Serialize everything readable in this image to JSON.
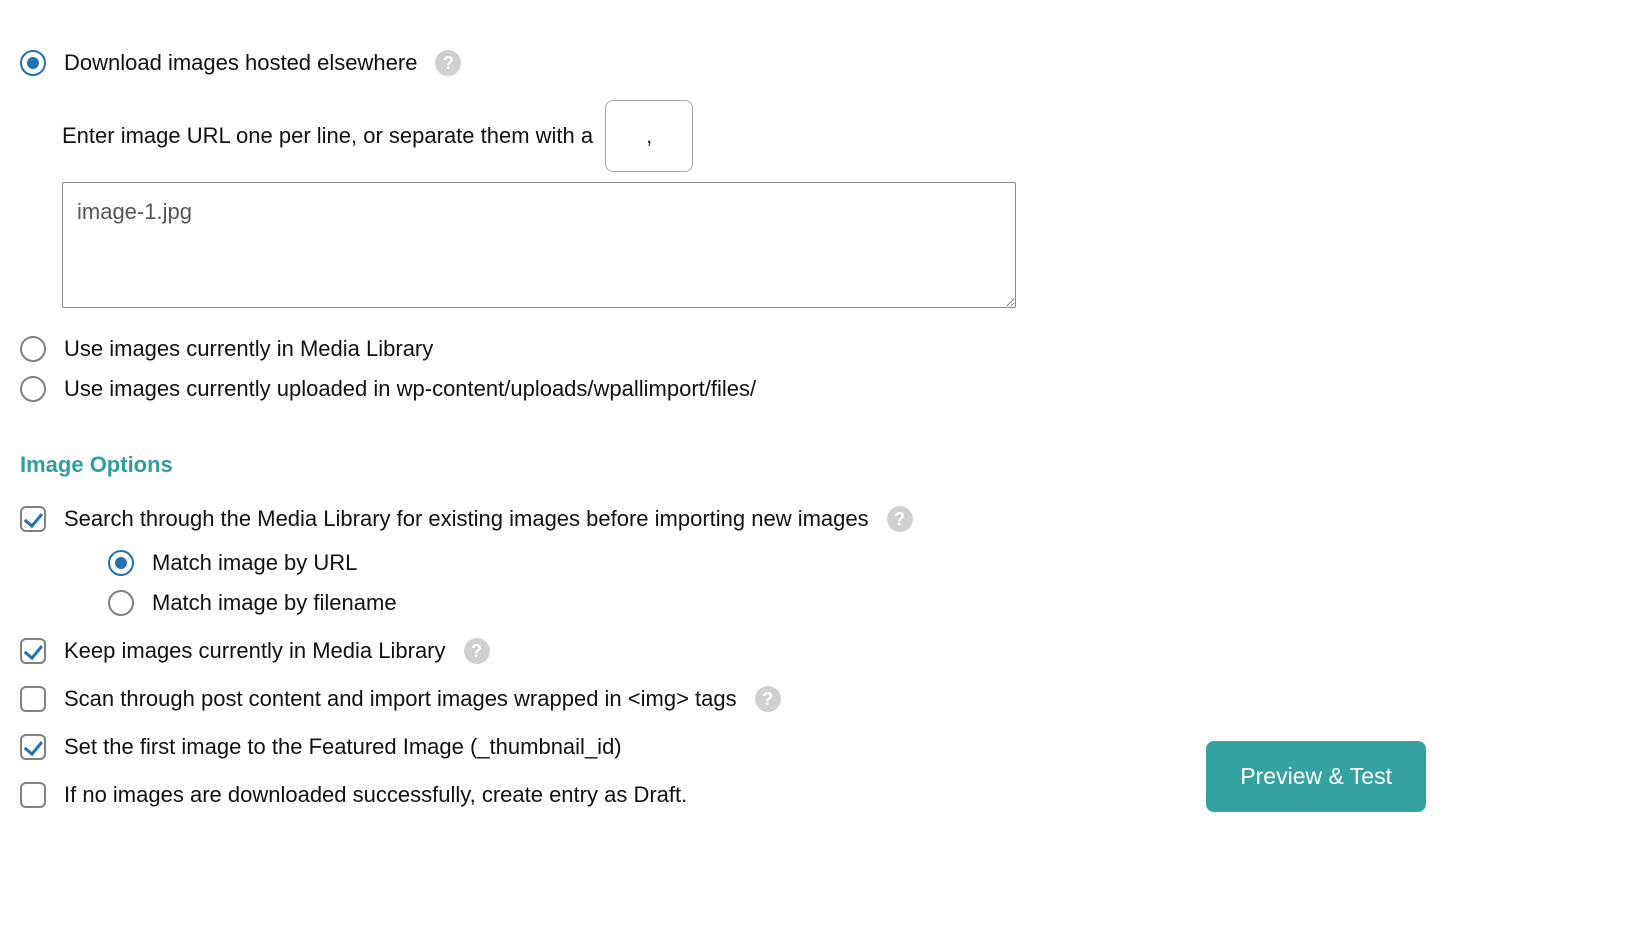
{
  "imageSource": {
    "download": {
      "label": "Download images hosted elsewhere",
      "selected": true,
      "instruction": "Enter image URL one per line, or separate them with a",
      "separator": ",",
      "urls": "image-1.jpg"
    },
    "mediaLibrary": {
      "label": "Use images currently in Media Library",
      "selected": false
    },
    "uploadsFolder": {
      "label": "Use images currently uploaded in wp-content/uploads/wpallimport/files/",
      "selected": false
    }
  },
  "imageOptions": {
    "heading": "Image Options",
    "searchExisting": {
      "label": "Search through the Media Library for existing images before importing new images",
      "checked": true,
      "matchBy": {
        "url": {
          "label": "Match image by URL",
          "selected": true
        },
        "filename": {
          "label": "Match image by filename",
          "selected": false
        }
      }
    },
    "keepImages": {
      "label": "Keep images currently in Media Library",
      "checked": true
    },
    "scanContent": {
      "label": "Scan through post content and import images wrapped in <img> tags",
      "checked": false
    },
    "setFeatured": {
      "label": "Set the first image to the Featured Image (_thumbnail_id)",
      "checked": true
    },
    "draftOnFail": {
      "label": "If no images are downloaded successfully, create entry as Draft.",
      "checked": false
    }
  },
  "actions": {
    "preview": "Preview & Test"
  },
  "helpGlyph": "?"
}
